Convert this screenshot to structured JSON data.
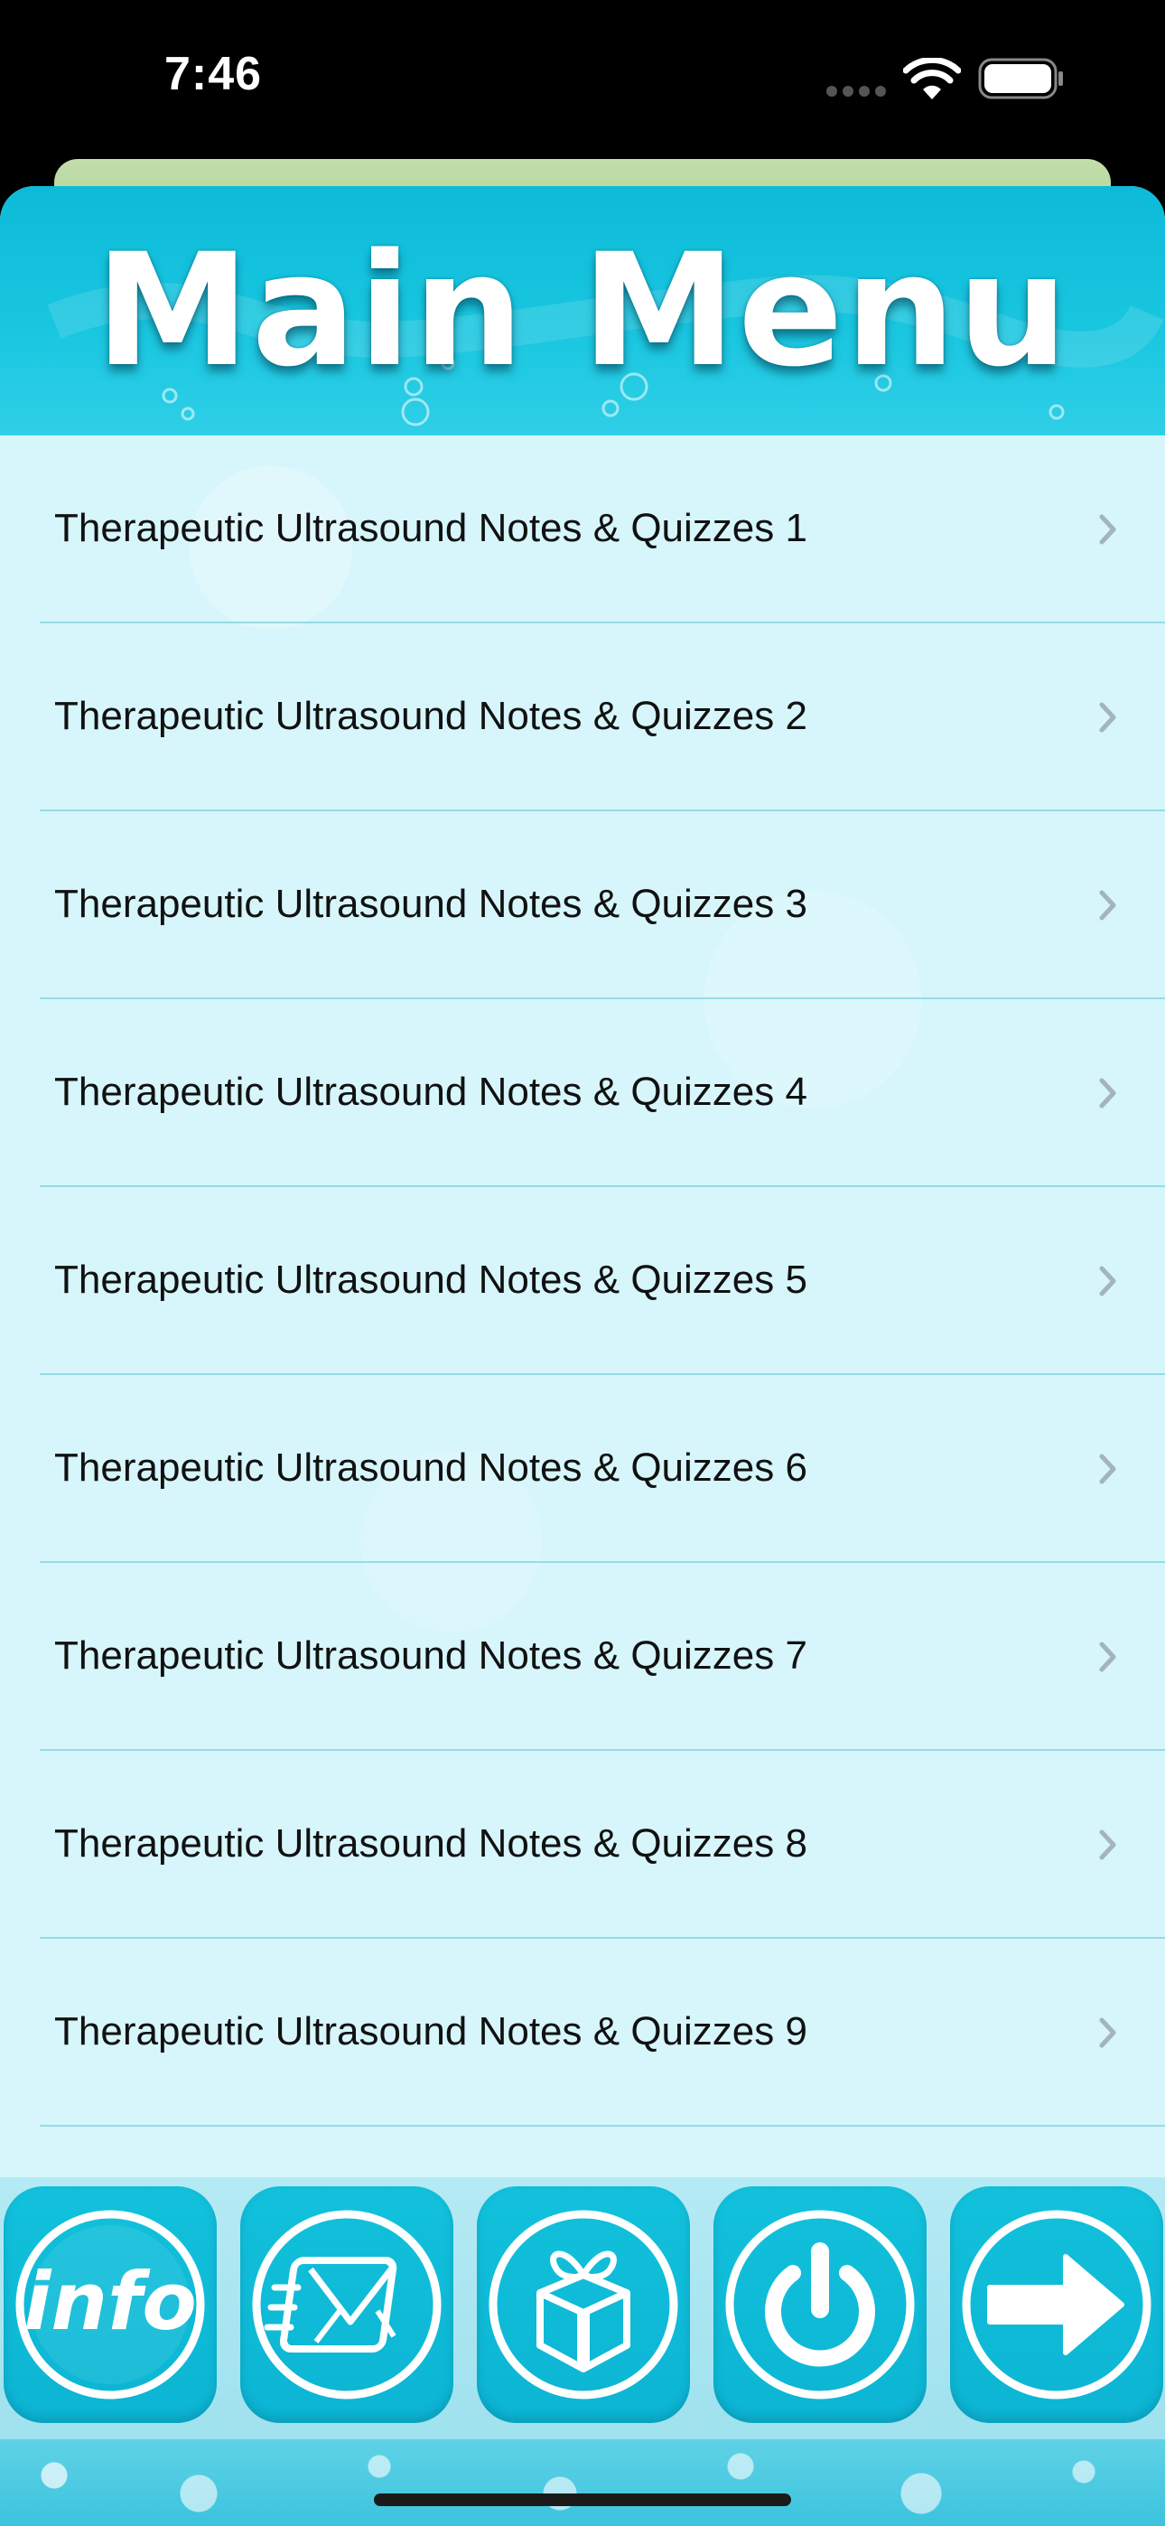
{
  "status_bar": {
    "time": "7:46"
  },
  "header": {
    "title": "Main Menu"
  },
  "menu": {
    "items": [
      {
        "label": "Therapeutic Ultrasound Notes & Quizzes 1"
      },
      {
        "label": "Therapeutic Ultrasound Notes & Quizzes 2"
      },
      {
        "label": "Therapeutic Ultrasound Notes & Quizzes 3"
      },
      {
        "label": "Therapeutic Ultrasound Notes & Quizzes 4"
      },
      {
        "label": "Therapeutic Ultrasound Notes & Quizzes 5"
      },
      {
        "label": "Therapeutic Ultrasound Notes & Quizzes 6"
      },
      {
        "label": "Therapeutic Ultrasound Notes & Quizzes 7"
      },
      {
        "label": "Therapeutic Ultrasound Notes & Quizzes 8"
      },
      {
        "label": "Therapeutic Ultrasound Notes & Quizzes 9"
      }
    ]
  },
  "toolbar": {
    "info_label": "info",
    "buttons": [
      "info-icon",
      "mail-icon",
      "gift-icon",
      "power-icon",
      "arrow-right-icon"
    ]
  },
  "colors": {
    "header": "#12c1dc",
    "list_background": "#d6f6fb",
    "separator": "#96dbe6",
    "toolbar_button": "#12c1dc"
  }
}
